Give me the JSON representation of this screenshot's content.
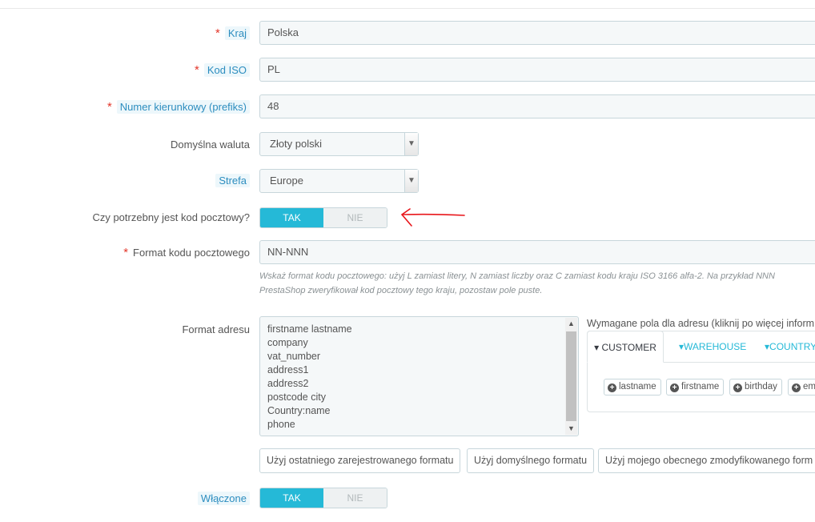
{
  "form": {
    "country": {
      "label": "Kraj",
      "value": "Polska",
      "required": true
    },
    "iso": {
      "label": "Kod ISO",
      "value": "PL",
      "required": true
    },
    "prefix": {
      "label": "Numer kierunkowy (prefiks)",
      "value": "48",
      "required": true
    },
    "currency": {
      "label": "Domyślna waluta",
      "value": "Złoty polski"
    },
    "zone": {
      "label": "Strefa",
      "value": "Europe"
    },
    "zip_needed": {
      "label": "Czy potrzebny jest kod pocztowy?",
      "on": "TAK",
      "off": "NIE",
      "state": "TAK"
    },
    "zip_format": {
      "label": "Format kodu pocztowego",
      "value": "NN-NNN",
      "required": true,
      "hint_line1": "Wskaż format kodu pocztowego: użyj L zamiast litery, N zamiast liczby oraz C zamiast kodu kraju ISO 3166 alfa-2. Na przykład NNN",
      "hint_line2": "PrestaShop zweryfikował kod pocztowy tego kraju, pozostaw pole puste."
    },
    "address_format": {
      "label": "Format adresu",
      "lines": [
        "firstname lastname",
        "company",
        "vat_number",
        "address1",
        "address2",
        "postcode city",
        "Country:name",
        "phone"
      ]
    },
    "required_fields": {
      "title": "Wymagane pola dla adresu (kliknij po więcej inform",
      "tabs": [
        "CUSTOMER",
        "WAREHOUSE",
        "COUNTRY"
      ],
      "chips": [
        "lastname",
        "firstname",
        "birthday",
        "em"
      ]
    },
    "buttons": {
      "last_format": "Użyj ostatniego zarejestrowanego formatu",
      "default_format": "Użyj domyślnego formatu",
      "my_format": "Użyj mojego obecnego zmodyfikowanego form"
    },
    "enabled": {
      "label": "Włączone",
      "on": "TAK",
      "off": "NIE",
      "state": "TAK"
    }
  },
  "colors": {
    "accent": "#25b9d7",
    "required": "#e3372b",
    "annotation": "#e8161b"
  }
}
